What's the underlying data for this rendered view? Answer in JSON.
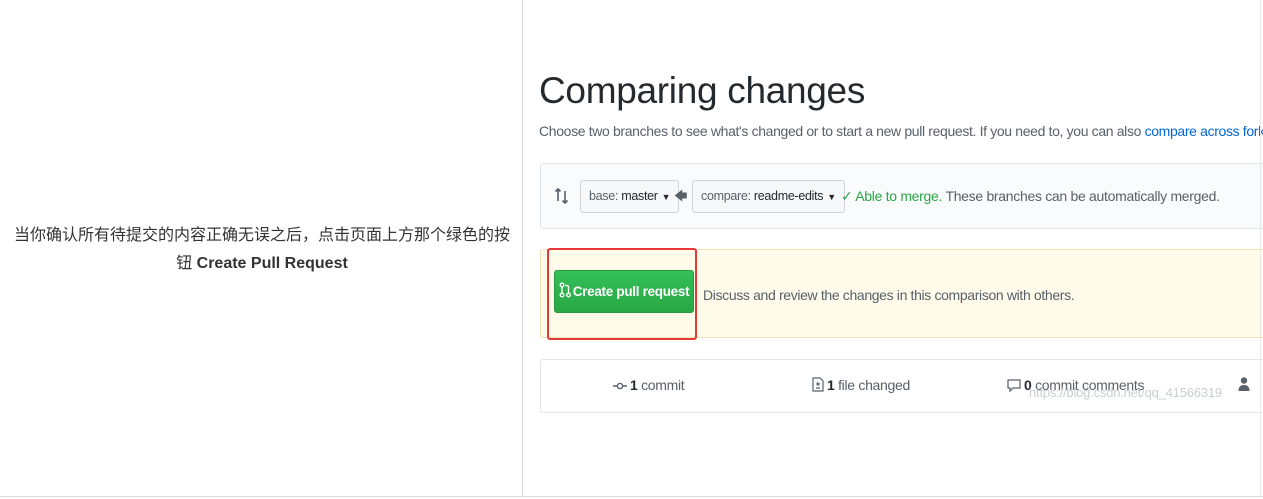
{
  "caption": {
    "text": "当你确认所有待提交的内容正确无误之后，点击页面上方那个绿色的按钮 ",
    "bold": "Create Pull Request"
  },
  "compare": {
    "title": "Comparing changes",
    "subtitle": "Choose two branches to see what's changed or to start a new pull request. If you need to, you can also ",
    "subtitle_link": "compare across forks.",
    "base_label": "base: ",
    "base_value": "master",
    "compare_label": "compare: ",
    "compare_value": "readme-edits",
    "merge_ok": "✓ Able to merge.",
    "merge_text": " These branches can be automatically merged.",
    "create_button": "Create pull request",
    "discuss_text": "Discuss and review the changes in this comparison with others.",
    "stats": {
      "commits_num": "1",
      "commits_label": " commit",
      "files_num": "1",
      "files_label": " file changed",
      "comments_num": "0",
      "comments_label": " commit comments"
    },
    "watermark": "https://blog.csdn.net/qq_41566319"
  },
  "colors": {
    "accent_green": "#28a745",
    "link_blue": "#0366d6",
    "highlight_red": "#e53935"
  },
  "icons": [
    "compare-arrows-icon",
    "caret-down-icon",
    "arrow-left-icon",
    "check-icon",
    "pull-request-icon",
    "commit-icon",
    "file-diff-icon",
    "comment-icon",
    "person-icon"
  ]
}
